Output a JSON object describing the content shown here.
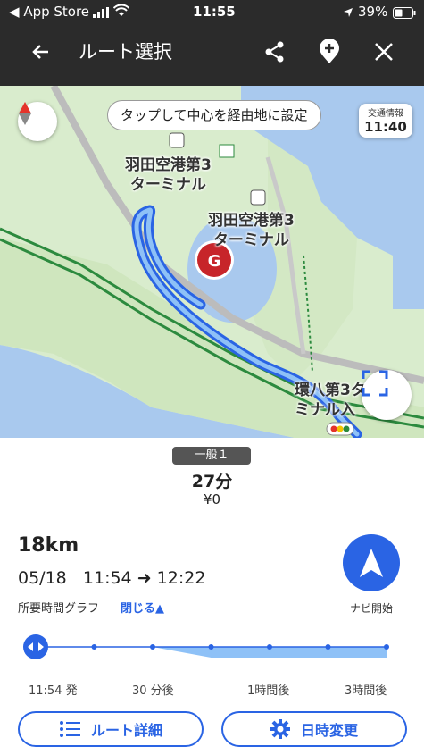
{
  "status_bar": {
    "back_app": "App Store",
    "time": "11:55",
    "battery": "39%"
  },
  "header": {
    "title": "ルート選択",
    "back_icon": "back-arrow-icon",
    "share_icon": "share-icon",
    "add_waypoint_icon": "add-waypoint-icon",
    "close_icon": "close-icon"
  },
  "map": {
    "hint": "タップして中心を経由地に設定",
    "traffic_label": "交通情報",
    "traffic_time": "11:40",
    "label_terminal3_a": "羽田空港第3\nターミナル",
    "label_terminal3_b": "羽田空港第3\nターミナル",
    "label_kanpachi": "環八第3タ\nミナル入",
    "route_color": "#2a64e4"
  },
  "summary": {
    "route_tag": "一般１",
    "duration": "27分",
    "fare": "¥0"
  },
  "details": {
    "distance": "18km",
    "date": "05/18",
    "depart": "11:54",
    "arrive": "12:22",
    "graph_label": "所要時間グラフ",
    "collapse_label": "閉じる▲",
    "nav_start_label": "ナビ開始",
    "graph_ticks": [
      "11:54 発",
      "30 分後",
      "1時間後",
      "3時間後"
    ],
    "graph_values_min": [
      27,
      27,
      27,
      30,
      30,
      30,
      30
    ]
  },
  "buttons": {
    "route_detail": "ルート詳細",
    "change_time": "日時変更"
  },
  "colors": {
    "accent": "#2a64e4",
    "header_bg": "#2b2b2b"
  }
}
